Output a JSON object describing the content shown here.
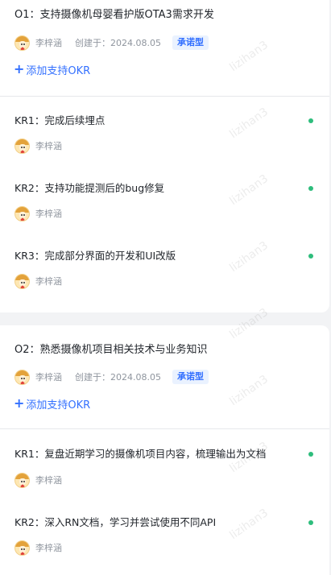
{
  "watermark": "lizihan3",
  "objectives": [
    {
      "title": "O1：支持摄像机母婴看护版OTA3需求开发",
      "owner": "李梓涵",
      "created": "创建于：2024.08.05",
      "tag": "承诺型",
      "add_link": "添加支持OKR",
      "key_results": [
        {
          "title": "KR1：完成后续埋点",
          "owner": "李梓涵"
        },
        {
          "title": "KR2：支持功能提测后的bug修复",
          "owner": "李梓涵"
        },
        {
          "title": "KR3：完成部分界面的开发和UI改版",
          "owner": "李梓涵"
        }
      ]
    },
    {
      "title": "O2：熟悉摄像机项目相关技术与业务知识",
      "owner": "李梓涵",
      "created": "创建于：2024.08.05",
      "tag": "承诺型",
      "add_link": "添加支持OKR",
      "key_results": [
        {
          "title": "KR1：复盘近期学习的摄像机项目内容，梳理输出为文档",
          "owner": "李梓涵"
        },
        {
          "title": "KR2：深入RN文档，学习并尝试使用不同API",
          "owner": "李梓涵"
        }
      ]
    }
  ],
  "colors": {
    "status_dot": "#2ebd7c",
    "link": "#3370ff",
    "tag_bg": "#eaf2ff"
  }
}
